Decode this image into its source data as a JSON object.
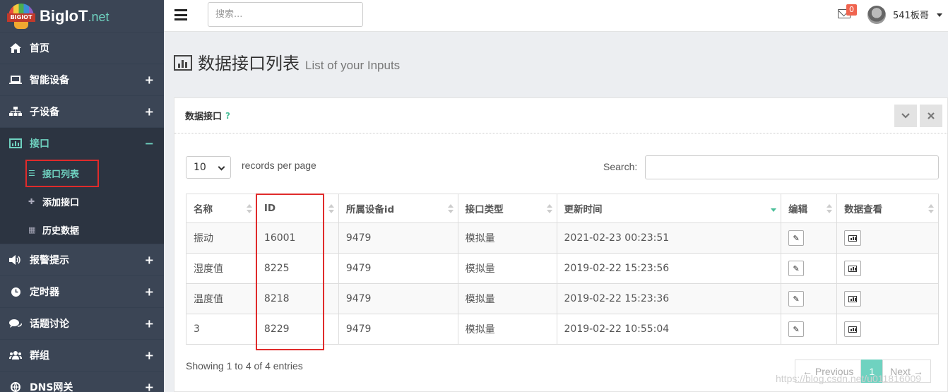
{
  "brand": {
    "logo_text": "BIGIOT",
    "name": "BigIoT",
    "suffix": ".net"
  },
  "sidebar": {
    "items": [
      {
        "label": "首页",
        "icon": "home-icon",
        "toggle": ""
      },
      {
        "label": "智能设备",
        "icon": "laptop-icon",
        "toggle": "+"
      },
      {
        "label": "子设备",
        "icon": "sitemap-icon",
        "toggle": "+"
      },
      {
        "label": "接口",
        "icon": "bar-chart-icon",
        "toggle": "−"
      },
      {
        "label": "报警提示",
        "icon": "volume-icon",
        "toggle": "+"
      },
      {
        "label": "定时器",
        "icon": "clock-icon",
        "toggle": "+"
      },
      {
        "label": "话题讨论",
        "icon": "comments-icon",
        "toggle": "+"
      },
      {
        "label": "群组",
        "icon": "users-icon",
        "toggle": "+"
      },
      {
        "label": "DNS网关",
        "icon": "network-icon",
        "toggle": "+"
      }
    ],
    "sub_items": [
      {
        "label": "接口列表",
        "icon": "list-icon"
      },
      {
        "label": "添加接口",
        "icon": "plus-icon"
      },
      {
        "label": "历史数据",
        "icon": "chart-icon"
      }
    ]
  },
  "topbar": {
    "search_placeholder": "搜索...",
    "mail_count": "0",
    "username": "541板哥"
  },
  "page": {
    "title": "数据接口列表",
    "subtitle": "List of your Inputs"
  },
  "box": {
    "title": "数据接口",
    "help": "?",
    "collapse_icon": "chevron-down-icon",
    "close_icon": "close-icon"
  },
  "controls": {
    "page_length": "10",
    "page_length_label": "records per page",
    "search_label": "Search:"
  },
  "table": {
    "headers": [
      "名称",
      "ID",
      "所属设备id",
      "接口类型",
      "更新时间",
      "编辑",
      "数据查看"
    ],
    "rows": [
      {
        "name": "振动",
        "id": "16001",
        "device_id": "9479",
        "type": "模拟量",
        "updated": "2021-02-23 00:23:51"
      },
      {
        "name": "湿度值",
        "id": "8225",
        "device_id": "9479",
        "type": "模拟量",
        "updated": "2019-02-22 15:23:56"
      },
      {
        "name": "温度值",
        "id": "8218",
        "device_id": "9479",
        "type": "模拟量",
        "updated": "2019-02-22 15:23:36"
      },
      {
        "name": "3",
        "id": "8229",
        "device_id": "9479",
        "type": "模拟量",
        "updated": "2019-02-22 10:55:04"
      }
    ]
  },
  "footer": {
    "info": "Showing 1 to 4 of 4 entries",
    "prev": "← Previous",
    "current_page": "1",
    "next": "Next →",
    "watermark": "https://blog.csdn.net/u011816009"
  },
  "colors": {
    "sidebar_bg": "#3b4555",
    "accent": "#6fd2c0",
    "highlight_box": "#e02b2b",
    "badge": "#f0644f"
  }
}
